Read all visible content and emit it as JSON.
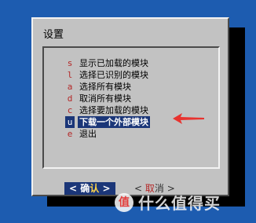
{
  "dialog": {
    "title": "设置"
  },
  "menu": {
    "items": [
      {
        "key": "s",
        "label": "显示已加载的模块"
      },
      {
        "key": "l",
        "label": "选择已识别的模块"
      },
      {
        "key": "a",
        "label": "选择所有模块"
      },
      {
        "key": "d",
        "label": "取消所有模块"
      },
      {
        "key": "c",
        "label": "选择要加载的模块"
      },
      {
        "key": "u",
        "label": "下载一个外部模块"
      },
      {
        "key": "e",
        "label": "退出"
      }
    ],
    "selected_index": 5
  },
  "buttons": {
    "ok": {
      "left_bracket": "<",
      "main": "确",
      "hotkey": "认",
      "right_bracket": ">"
    },
    "cancel": {
      "left_bracket": "<",
      "hotkey": "取",
      "main": "消",
      "right_bracket": ">"
    }
  },
  "watermark": {
    "badge": "值",
    "text": "什么值得买"
  },
  "colors": {
    "background": "#1d5cb0",
    "dialog": "#c2c2c2",
    "selection": "#1b3678",
    "hotkey": "#b42828",
    "arrow": "#e8332f"
  }
}
